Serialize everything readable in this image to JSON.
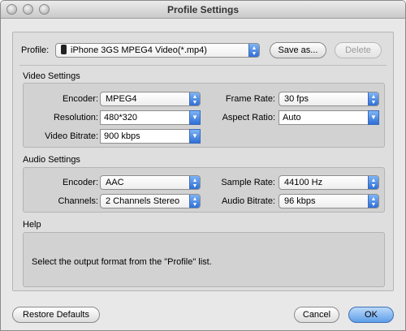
{
  "window": {
    "title": "Profile Settings"
  },
  "profile": {
    "label": "Profile:",
    "value": "iPhone 3GS MPEG4 Video(*.mp4)",
    "save_as": "Save as...",
    "delete": "Delete"
  },
  "video": {
    "title": "Video Settings",
    "encoder_label": "Encoder:",
    "encoder_value": "MPEG4",
    "frame_rate_label": "Frame Rate:",
    "frame_rate_value": "30 fps",
    "resolution_label": "Resolution:",
    "resolution_value": "480*320",
    "aspect_ratio_label": "Aspect Ratio:",
    "aspect_ratio_value": "Auto",
    "bitrate_label": "Video Bitrate:",
    "bitrate_value": "900 kbps"
  },
  "audio": {
    "title": "Audio Settings",
    "encoder_label": "Encoder:",
    "encoder_value": "AAC",
    "sample_rate_label": "Sample Rate:",
    "sample_rate_value": "44100 Hz",
    "channels_label": "Channels:",
    "channels_value": "2 Channels Stereo",
    "bitrate_label": "Audio Bitrate:",
    "bitrate_value": "96 kbps"
  },
  "help": {
    "title": "Help",
    "text": "Select the output format from the \"Profile\" list."
  },
  "footer": {
    "restore": "Restore Defaults",
    "cancel": "Cancel",
    "ok": "OK"
  }
}
